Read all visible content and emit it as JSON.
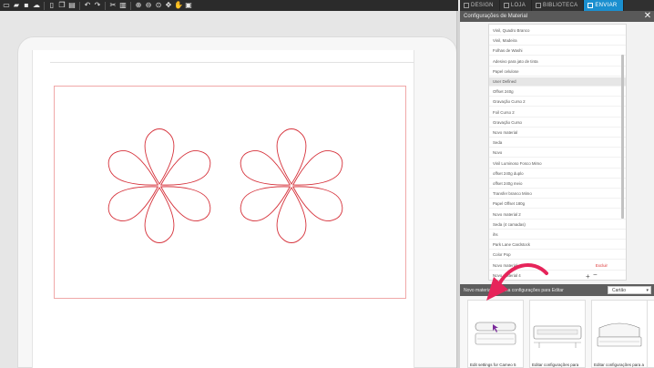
{
  "toolbar": {
    "icons": [
      "new-file-icon",
      "open-folder-icon",
      "save-icon",
      "cloud-save-icon",
      "delete-icon",
      "copy-icon",
      "paste-icon",
      "undo-icon",
      "redo-icon",
      "cut-icon",
      "select-icon",
      "zoom-in-icon",
      "zoom-out-icon",
      "zoom-fit-icon",
      "zoom-drag-icon",
      "pan-icon",
      "fit-page-icon"
    ]
  },
  "tabs": [
    {
      "label": "DESIGN",
      "active": false
    },
    {
      "label": "LOJA",
      "active": false
    },
    {
      "label": "BIBLIOTECA",
      "active": false
    },
    {
      "label": "ENVIAR",
      "active": true
    }
  ],
  "panel": {
    "title": "Configurações de Material"
  },
  "materials": [
    "Vinil, Quadro Branco",
    "Vinil, Madeira",
    "Folhas de Washi",
    "Adesivo para jato de tinta",
    "Papel celulose",
    "User Defined",
    "Offset 240g",
    "Gravação Curso 2",
    "Foil Curso 2",
    "Gravação Curso",
    "Novo material",
    "Seda",
    "Novo",
    "Vinil Luminoso Fosco Mimo",
    "offset 240g duplo",
    "offset 240g meio",
    "Transfer branco Mimo",
    "Papel Offset 180g",
    "Novo material 2",
    "Seda (4 camadas)",
    "ihs",
    "Park Lane Cardstock",
    "Color Pop",
    "Novo material",
    "Novo material 4"
  ],
  "selected_material_index": 5,
  "excluir_label": "Excluir",
  "list_controls": {
    "add": "+",
    "remove": "−"
  },
  "section": {
    "label": "Novo material: Escolha configurações para Editar",
    "select_value": "Cartão"
  },
  "machines": [
    {
      "caption": "Edit settings for Cameo 5"
    },
    {
      "caption": "Editar configurações para"
    },
    {
      "caption": "Editar configurações para a"
    }
  ],
  "colors": {
    "accent": "#1a8fcf",
    "cut_line": "#d6323b",
    "annotation_arrow": "#e6245a"
  }
}
